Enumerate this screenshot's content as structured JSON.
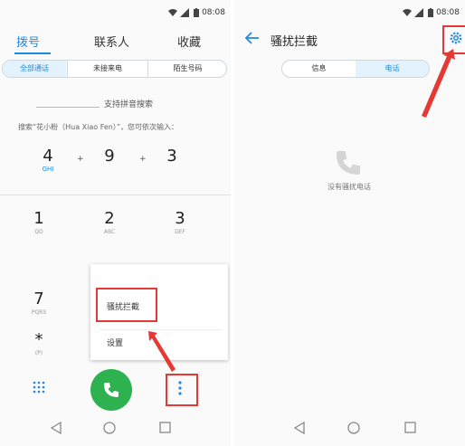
{
  "status": {
    "time": "08:08"
  },
  "left": {
    "tabs": [
      {
        "label": "拨号"
      },
      {
        "label": "联系人"
      },
      {
        "label": "收藏"
      }
    ],
    "filters": [
      {
        "label": "全部通话"
      },
      {
        "label": "未接来电"
      },
      {
        "label": "陌生号码"
      }
    ],
    "search_hint": "支持拼音搜索",
    "example_text": "搜索“花小粉（Hua Xiao Fen）”，您可依次输入：",
    "example_keys": [
      {
        "num": "4",
        "letters": "GHI"
      },
      {
        "num": "9",
        "letters": ""
      },
      {
        "num": "3",
        "letters": ""
      }
    ],
    "plus": "+",
    "keypad": [
      {
        "num": "1",
        "letters": "QD"
      },
      {
        "num": "2",
        "letters": "ABC"
      },
      {
        "num": "3",
        "letters": "DEF"
      },
      {
        "num": "7",
        "letters": "PQRS"
      },
      {
        "num": "*",
        "letters": "(P)"
      }
    ],
    "menu": [
      {
        "label": "骚扰拦截"
      },
      {
        "label": "设置"
      }
    ]
  },
  "right": {
    "title": "骚扰拦截",
    "tabs": [
      {
        "label": "信息"
      },
      {
        "label": "电话"
      }
    ],
    "empty_text": "没有骚扰电话"
  },
  "colors": {
    "accent": "#1e88e5",
    "call_green": "#2eb24f",
    "highlight_red": "#e53935"
  }
}
